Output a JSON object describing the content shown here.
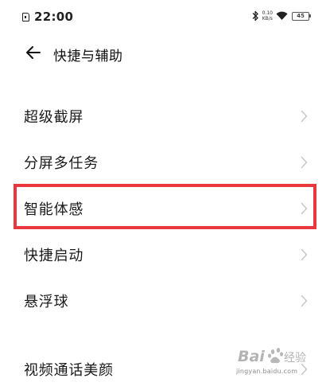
{
  "status_bar": {
    "time": "22:00",
    "net_speed_value": "0.10",
    "net_speed_unit": "KB/s",
    "battery_level": "45"
  },
  "header": {
    "title": "快捷与辅助"
  },
  "list": {
    "items": [
      {
        "label": "超级截屏"
      },
      {
        "label": "分屏多任务"
      },
      {
        "label": "智能体感"
      },
      {
        "label": "快捷启动"
      },
      {
        "label": "悬浮球"
      },
      {
        "label": "视频通话美颜"
      }
    ]
  },
  "highlight": {
    "color": "#e8383d",
    "target": "智能体感"
  },
  "watermark": {
    "text": "Baidu 经验",
    "url": "jingyan.baidu.com"
  }
}
